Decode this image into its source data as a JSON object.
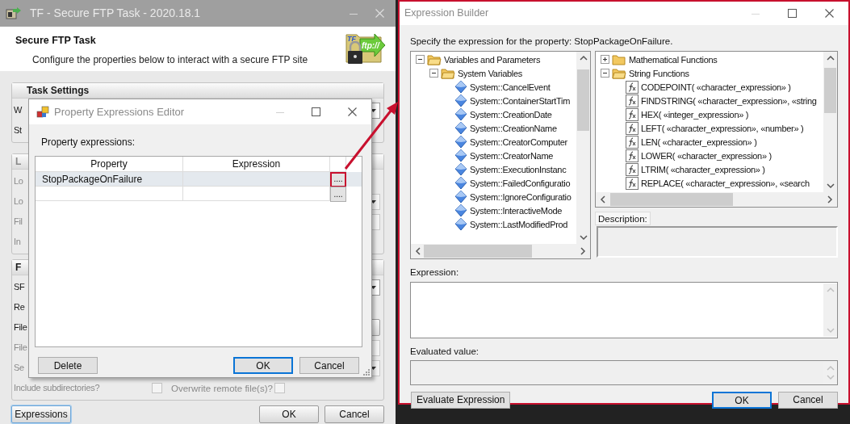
{
  "main_window": {
    "title": "TF - Secure FTP Task - 2020.18.1",
    "header_title": "Secure FTP Task",
    "header_subtitle": "Configure the properties below to interact with a secure FTP site",
    "logo": {
      "badge": "TF",
      "arrow_text": "ftp://"
    },
    "groups": [
      {
        "header": "Task Settings",
        "disabled": false,
        "rows": [
          {
            "label": "W",
            "kind": "dropdown",
            "disabled": false
          },
          {
            "label": "St",
            "kind": "plain",
            "disabled": false
          }
        ]
      },
      {
        "header": "L",
        "disabled": true,
        "rows": [
          {
            "label": "Lo",
            "kind": "plain",
            "disabled": true
          },
          {
            "label": "Lo",
            "kind": "dropdown",
            "disabled": true
          },
          {
            "label": "Fil",
            "kind": "field",
            "disabled": true
          },
          {
            "label": "In",
            "kind": "plain",
            "disabled": true
          }
        ]
      },
      {
        "header": "F",
        "disabled": false,
        "rows": [
          {
            "label": "SF",
            "kind": "dropdown",
            "disabled": false
          },
          {
            "label": "Re",
            "kind": "plain",
            "disabled": false
          },
          {
            "label": "File",
            "kind": "button",
            "disabled": false
          },
          {
            "label": "File",
            "kind": "field",
            "disabled": true
          },
          {
            "label": "Se",
            "kind": "dropdown",
            "disabled": true
          },
          {
            "label": "Include subdirectories?",
            "kind": "checkboxes",
            "disabled": true,
            "checked": false,
            "second_label": "Overwrite remote file(s)?",
            "second_checked": false
          }
        ]
      }
    ],
    "buttons": [
      {
        "label": "Expressions",
        "focused": true
      },
      {
        "label": "OK",
        "focused": false
      },
      {
        "label": "Cancel",
        "focused": false
      }
    ]
  },
  "property_editor": {
    "title": "Property Expressions Editor",
    "label": "Property expressions:",
    "columns": [
      "Property",
      "Expression"
    ],
    "rows": [
      {
        "property": "StopPackageOnFailure",
        "button": "....",
        "selected": true,
        "annotated": true
      },
      {
        "button": "....",
        "selected": false,
        "annotated": false
      }
    ],
    "buttons": [
      {
        "label": "Delete",
        "default": false
      },
      {
        "label": "OK",
        "default": true
      },
      {
        "label": "Cancel",
        "default": false
      }
    ]
  },
  "expression_builder": {
    "title": "Expression Builder",
    "prompt": "Specify the expression for the property: StopPackageOnFailure.",
    "variables_tree": [
      {
        "label": "Variables and Parameters",
        "kind": "folder",
        "expanded": true,
        "children": [
          {
            "label": "System Variables",
            "kind": "folder",
            "expanded": true,
            "children": [
              {
                "label": "System::CancelEvent",
                "kind": "variable"
              },
              {
                "label": "System::ContainerStartTim",
                "kind": "variable"
              },
              {
                "label": "System::CreationDate",
                "kind": "variable"
              },
              {
                "label": "System::CreationName",
                "kind": "variable"
              },
              {
                "label": "System::CreatorComputer",
                "kind": "variable"
              },
              {
                "label": "System::CreatorName",
                "kind": "variable"
              },
              {
                "label": "System::ExecutionInstanc",
                "kind": "variable"
              },
              {
                "label": "System::FailedConfiguratio",
                "kind": "variable"
              },
              {
                "label": "System::IgnoreConfiguratio",
                "kind": "variable"
              },
              {
                "label": "System::InteractiveMode",
                "kind": "variable"
              },
              {
                "label": "System::LastModifiedProd",
                "kind": "variable"
              }
            ]
          }
        ]
      }
    ],
    "functions_tree": [
      {
        "label": "Mathematical Functions",
        "kind": "folder",
        "expanded": false
      },
      {
        "label": "String Functions",
        "kind": "folder",
        "expanded": true,
        "children": [
          {
            "label": "CODEPOINT( «character_expression» )",
            "kind": "function"
          },
          {
            "label": "FINDSTRING( «character_expression», «string",
            "kind": "function"
          },
          {
            "label": "HEX( «integer_expression» )",
            "kind": "function"
          },
          {
            "label": "LEFT( «character_expression», «number» )",
            "kind": "function"
          },
          {
            "label": "LEN( «character_expression» )",
            "kind": "function"
          },
          {
            "label": "LOWER( «character_expression» )",
            "kind": "function"
          },
          {
            "label": "LTRIM( «character_expression» )",
            "kind": "function"
          },
          {
            "label": "REPLACE( «character_expression», «search",
            "kind": "function"
          }
        ]
      }
    ],
    "description_label": "Description:",
    "expression_label": "Expression:",
    "evaluated_label": "Evaluated value:",
    "buttons": [
      {
        "label": "Evaluate Expression",
        "default": false
      },
      {
        "label": "OK",
        "default": true
      },
      {
        "label": "Cancel",
        "default": false
      }
    ]
  }
}
